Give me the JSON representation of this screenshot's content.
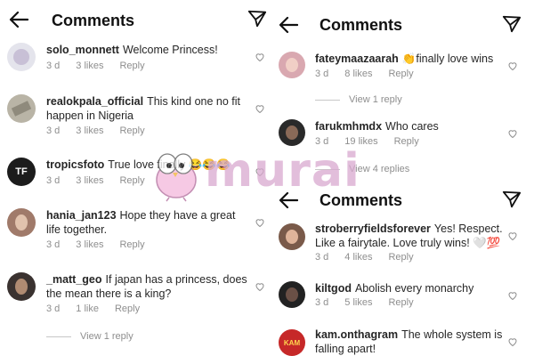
{
  "left": {
    "title": "Comments",
    "comments": [
      {
        "user": "solo_monnett",
        "text": "Welcome Princess!",
        "time": "3 d",
        "likes": "3 likes",
        "reply": "Reply"
      },
      {
        "user": "realokpala_official",
        "text": "This kind one no fit happen in Nigeria",
        "time": "3 d",
        "likes": "3 likes",
        "reply": "Reply"
      },
      {
        "user": "tropicsfoto",
        "text": "True love finally",
        "emoji": "😂😂😂",
        "time": "3 d",
        "likes": "3 likes",
        "reply": "Reply",
        "avatar_text": "TF"
      },
      {
        "user": "hania_jan123",
        "text": "Hope they have a great life together.",
        "time": "3 d",
        "likes": "3 likes",
        "reply": "Reply"
      },
      {
        "user": "_matt_geo",
        "text": "If japan has a princess, does the mean there is a king?",
        "time": "3 d",
        "likes": "1 like",
        "reply": "Reply"
      }
    ],
    "view_reply": "View 1 reply"
  },
  "right_top": {
    "title": "Comments",
    "comments": [
      {
        "user": "fateymaazaarah",
        "emoji": "👏",
        "text": "finally love wins",
        "time": "3 d",
        "likes": "8 likes",
        "reply": "Reply"
      },
      {
        "user": "farukmhmdx",
        "text": "Who cares",
        "time": "3 d",
        "likes": "19 likes",
        "reply": "Reply"
      }
    ],
    "view_reply_1": "View 1 reply",
    "view_reply_2": "View 4 replies"
  },
  "right_bottom": {
    "title": "Comments",
    "comments": [
      {
        "user": "stroberryfieldsforever",
        "text": "Yes! Respect. Like a fairytale. Love truly wins!",
        "emoji": "🤍💯",
        "time": "3 d",
        "likes": "4 likes",
        "reply": "Reply"
      },
      {
        "user": "kiltgod",
        "text": "Abolish every monarchy",
        "time": "3 d",
        "likes": "5 likes",
        "reply": "Reply"
      },
      {
        "user": "kam.onthagram",
        "text": "The whole system is falling apart!",
        "avatar_text": "KAM",
        "time": "",
        "likes": "",
        "reply": ""
      }
    ]
  },
  "watermark": {
    "text": "murai"
  },
  "colors": {
    "meta": "#8e8e8e",
    "text": "#262626",
    "watermark": "#d9a9cf"
  },
  "icons": [
    "back-arrow-icon",
    "send-icon",
    "heart-icon"
  ]
}
